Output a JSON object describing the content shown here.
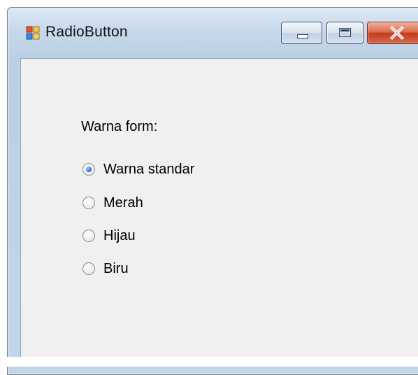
{
  "window": {
    "title": "RadioButton",
    "icon": "form-icon",
    "controls": [
      "minimize-icon",
      "maximize-icon",
      "close-icon"
    ],
    "close_color": "#c43c1e"
  },
  "form": {
    "group_label": "Warna form:",
    "radio_options": [
      {
        "label": "Warna standar",
        "selected": true
      },
      {
        "label": "Merah",
        "selected": false
      },
      {
        "label": "Hijau",
        "selected": false
      },
      {
        "label": "Biru",
        "selected": false
      }
    ],
    "accent": "#2f7fd6"
  }
}
